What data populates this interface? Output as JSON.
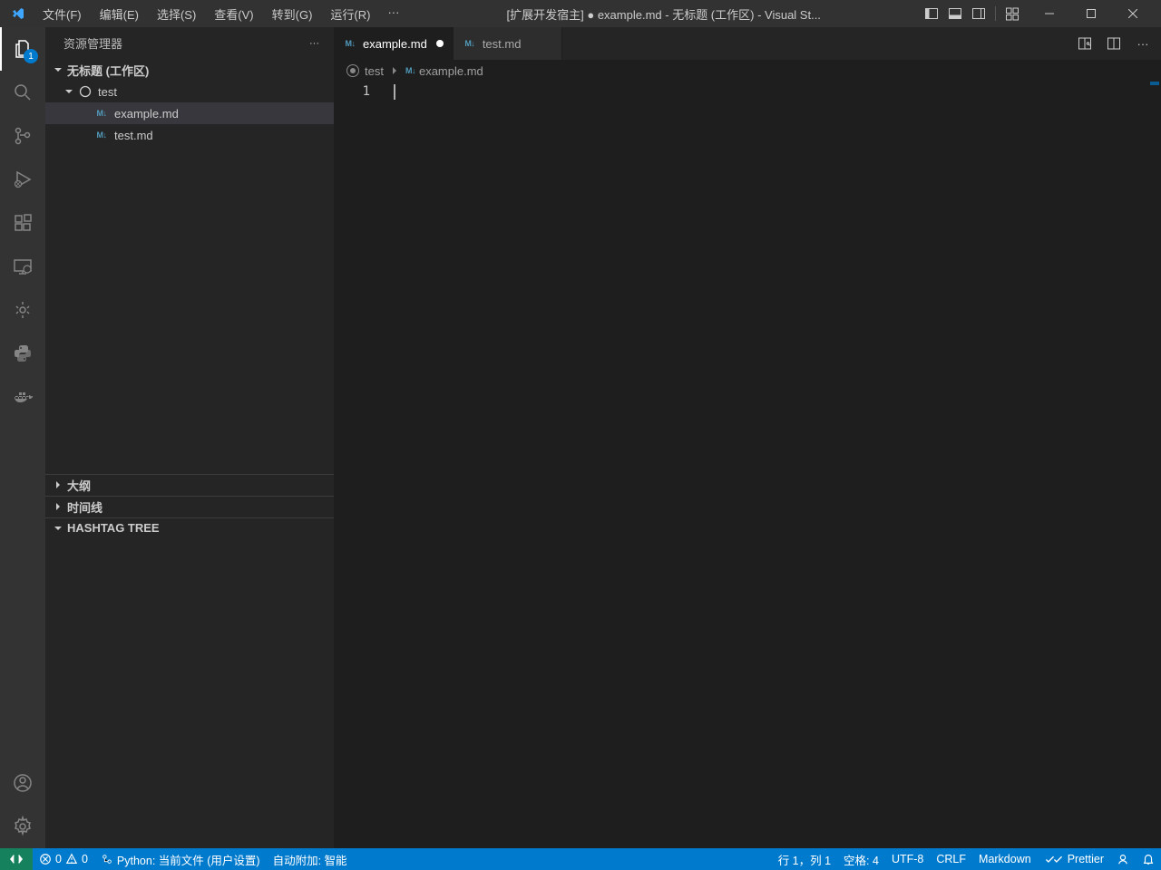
{
  "titlebar": {
    "menu": [
      "文件(F)",
      "编辑(E)",
      "选择(S)",
      "查看(V)",
      "转到(G)",
      "运行(R)"
    ],
    "more": "···",
    "title": "[扩展开发宿主] ● example.md - 无标题 (工作区) - Visual St..."
  },
  "activitybar": {
    "explorer_badge": "1"
  },
  "sidebar": {
    "title": "资源管理器",
    "more": "···",
    "workspace_label": "无标题 (工作区)",
    "folder_label": "test",
    "files": {
      "example": "example.md",
      "test": "test.md"
    },
    "outline_label": "大纲",
    "timeline_label": "时间线",
    "hashtag_label": "HASHTAG TREE"
  },
  "tabs": {
    "example": "example.md",
    "test": "test.md",
    "more": "···"
  },
  "breadcrumb": {
    "folder": "test",
    "file": "example.md"
  },
  "editor": {
    "line1_number": "1"
  },
  "statusbar": {
    "errors": "0",
    "warnings": "0",
    "python": "Python: 当前文件 (用户设置)",
    "auto_attach": "自动附加: 智能",
    "cursor": "行 1，列 1",
    "spaces": "空格: 4",
    "encoding": "UTF-8",
    "eol": "CRLF",
    "language": "Markdown",
    "prettier": "Prettier"
  },
  "icons": {
    "md": "M↓"
  }
}
